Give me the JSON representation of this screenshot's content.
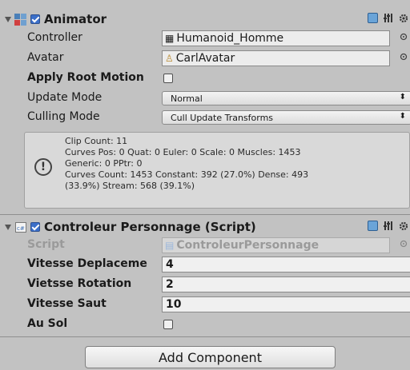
{
  "animator": {
    "title": "Animator",
    "enabled": true,
    "fields": {
      "controller_label": "Controller",
      "controller_value": "Humanoid_Homme",
      "avatar_label": "Avatar",
      "avatar_value": "CarlAvatar",
      "apply_root_motion_label": "Apply Root Motion",
      "apply_root_motion_checked": false,
      "update_mode_label": "Update Mode",
      "update_mode_value": "Normal",
      "culling_mode_label": "Culling Mode",
      "culling_mode_value": "Cull Update Transforms"
    },
    "info": {
      "line1": "Clip Count: 11",
      "line2": "Curves Pos: 0 Quat: 0 Euler: 0 Scale: 0 Muscles: 1453",
      "line3": "Generic: 0 PPtr: 0",
      "line4": "Curves Count: 1453 Constant: 392 (27.0%) Dense: 493",
      "line5": "(33.9%) Stream: 568 (39.1%)",
      "icon": "!"
    }
  },
  "script_component": {
    "title": "Controleur Personnage (Script)",
    "enabled": true,
    "script_label": "Script",
    "script_value": "ControleurPersonnage",
    "fields": [
      {
        "label": "Vitesse Deplaceme",
        "value": "4"
      },
      {
        "label": "Vietsse Rotation",
        "value": "2"
      },
      {
        "label": "Vitesse Saut",
        "value": "10"
      }
    ],
    "au_sol_label": "Au Sol",
    "au_sol_checked": false
  },
  "add_component_label": "Add Component",
  "icons": {
    "help": "book-icon",
    "settings": "sliders-icon",
    "gear": "gear-icon"
  },
  "colors": {
    "panel": "#c2c2c2",
    "accent": "#3b6fc9"
  }
}
